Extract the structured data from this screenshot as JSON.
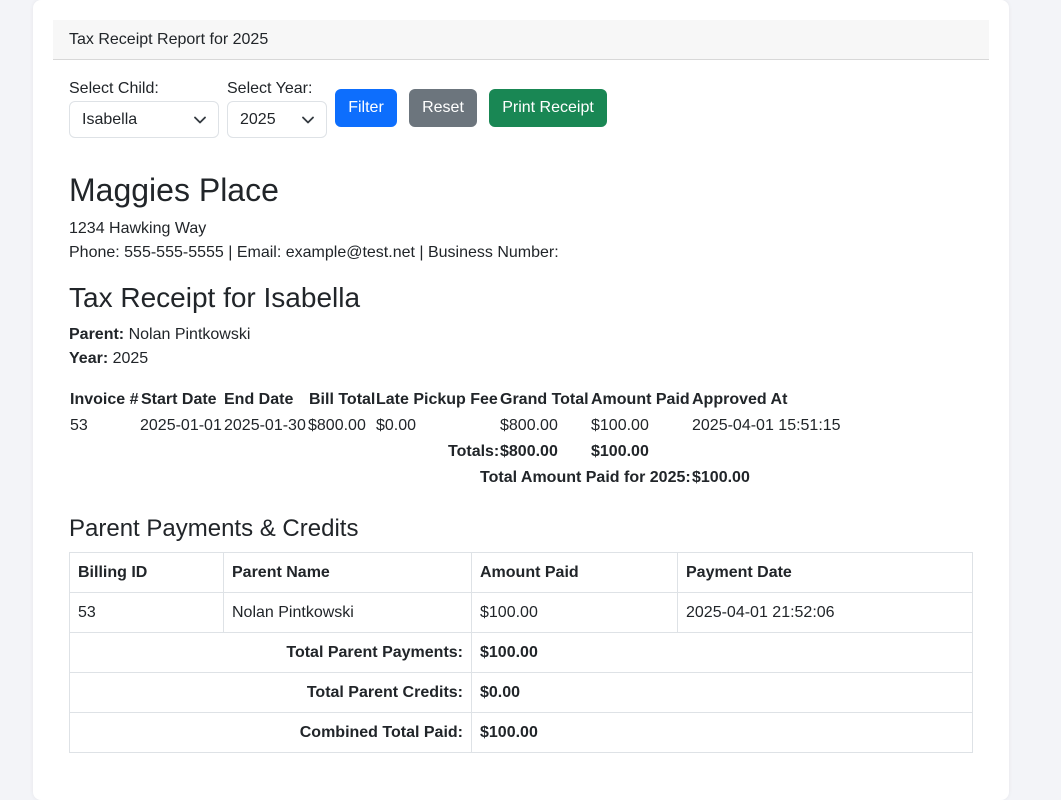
{
  "header": {
    "title": "Tax Receipt Report for 2025"
  },
  "filters": {
    "child_label": "Select Child:",
    "child_value": "Isabella",
    "year_label": "Select Year:",
    "year_value": "2025",
    "filter_btn": "Filter",
    "reset_btn": "Reset",
    "print_btn": "Print Receipt"
  },
  "business": {
    "name": "Maggies Place",
    "address": "1234 Hawking Way",
    "contact": "Phone: 555-555-5555 | Email: example@test.net | Business Number:"
  },
  "receipt": {
    "title": "Tax Receipt for Isabella",
    "parent_label": "Parent:",
    "parent_value": "Nolan Pintkowski",
    "year_label": "Year:",
    "year_value": "2025"
  },
  "invoices": {
    "headers": [
      "Invoice #",
      "Start Date",
      "End Date",
      "Bill Total",
      "Late Pickup Fee",
      "Grand Total",
      "Amount Paid",
      "Approved At"
    ],
    "rows": [
      [
        "53",
        "2025-01-01",
        "2025-01-30",
        "$800.00",
        "$0.00",
        "$800.00",
        "$100.00",
        "2025-04-01 15:51:15"
      ]
    ],
    "totals_label": "Totals:",
    "totals_grand": "$800.00",
    "totals_paid": "$100.00",
    "year_total_label": "Total Amount Paid for 2025:",
    "year_total_value": "$100.00"
  },
  "payments": {
    "title": "Parent Payments & Credits",
    "headers": [
      "Billing ID",
      "Parent Name",
      "Amount Paid",
      "Payment Date"
    ],
    "rows": [
      [
        "53",
        "Nolan Pintkowski",
        "$100.00",
        "2025-04-01 21:52:06"
      ]
    ],
    "total_payments_label": "Total Parent Payments:",
    "total_payments_value": "$100.00",
    "total_credits_label": "Total Parent Credits:",
    "total_credits_value": "$0.00",
    "combined_label": "Combined Total Paid:",
    "combined_value": "$100.00"
  }
}
